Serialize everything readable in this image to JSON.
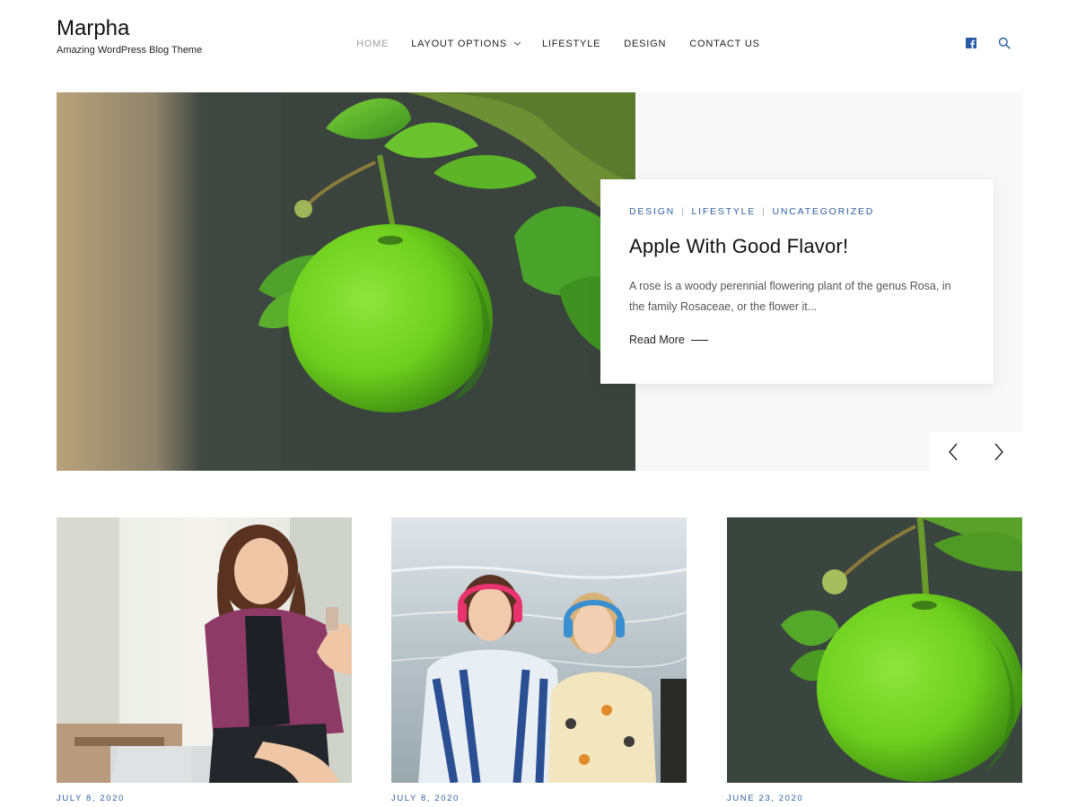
{
  "site": {
    "title": "Marpha",
    "tagline": "Amazing WordPress Blog Theme"
  },
  "nav": {
    "items": [
      {
        "label": "HOME",
        "active": true
      },
      {
        "label": "LAYOUT OPTIONS",
        "has_submenu": true
      },
      {
        "label": "LIFESTYLE"
      },
      {
        "label": "DESIGN"
      },
      {
        "label": "CONTACT US"
      }
    ],
    "icons": [
      "facebook-icon",
      "search-icon"
    ]
  },
  "hero": {
    "categories": [
      "DESIGN",
      "LIFESTYLE",
      "UNCATEGORIZED"
    ],
    "separator": "|",
    "title": "Apple With Good Flavor!",
    "excerpt": "A rose is a woody perennial flowering plant of the genus Rosa, in the family Rosaceae, or the flower it...",
    "read_more": "Read More",
    "prev_icon": "chevron-left-icon",
    "next_icon": "chevron-right-icon"
  },
  "posts": [
    {
      "date": "JULY 8, 2020",
      "image": "woman-with-phone-photo"
    },
    {
      "date": "JULY 8, 2020",
      "image": "women-with-headphones-photo"
    },
    {
      "date": "JUNE 23, 2020",
      "image": "green-apple-photo"
    }
  ],
  "colors": {
    "accent": "#2e5f9e",
    "facebook": "#2a5da8",
    "nav_active": "#a0a0a0"
  }
}
